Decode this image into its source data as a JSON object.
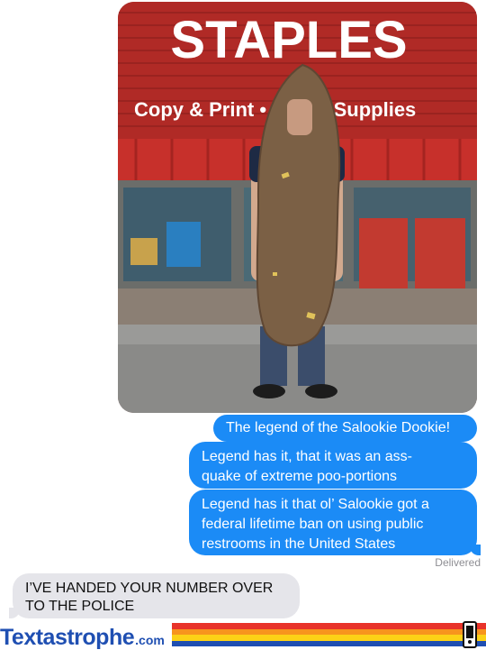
{
  "photo": {
    "sign_text": "STAPLES",
    "sign_subtext": "Copy & Print • Office Supplies",
    "description_icon": "person-in-costume-photo"
  },
  "messages": {
    "sent": [
      {
        "text": "The legend of the Salookie Dookie!"
      },
      {
        "text": "Legend has it, that it was an ass-\nquake of extreme poo-portions"
      },
      {
        "text": "Legend has it that ol’ Salookie got a\nfederal lifetime ban on using public\nrestrooms in the United States"
      }
    ],
    "status": "Delivered",
    "received": [
      {
        "text": "I’VE HANDED YOUR NUMBER OVER\nTO THE POLICE"
      }
    ]
  },
  "footer": {
    "logo_main": "Textastrophe",
    "logo_tld": ".com",
    "stripe_colors": [
      "#e8332a",
      "#f7941d",
      "#fcd116",
      "#1f4fb2"
    ],
    "icon": "phone-icon"
  },
  "colors": {
    "sent_bubble": "#1b8bf6",
    "received_bubble": "#e5e5ea",
    "store_red": "#b32a25"
  }
}
